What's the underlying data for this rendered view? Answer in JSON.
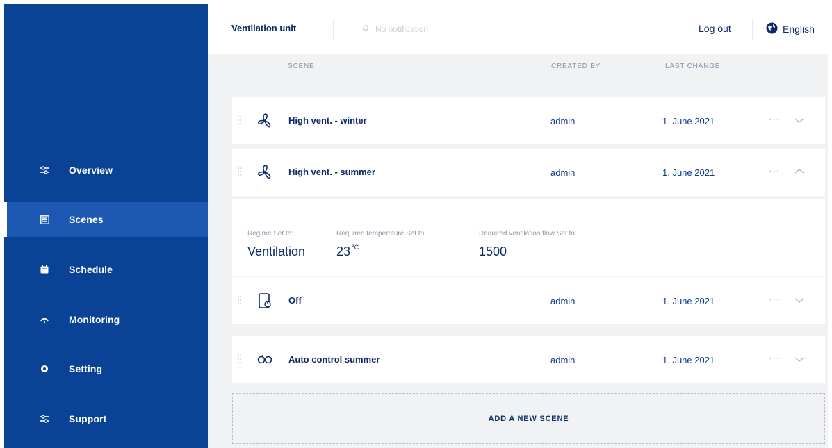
{
  "sidebar": {
    "items": [
      {
        "label": "Overview",
        "icon": "sliders-icon"
      },
      {
        "label": "Scenes",
        "icon": "list-icon",
        "active": true
      },
      {
        "label": "Schedule",
        "icon": "calendar-icon"
      },
      {
        "label": "Monitoring",
        "icon": "gauge-icon"
      },
      {
        "label": "Setting",
        "icon": "gear-icon"
      },
      {
        "label": "Support",
        "icon": "sliders-icon"
      }
    ]
  },
  "topbar": {
    "unit_title": "Ventilation unit",
    "notification": "No notification",
    "logout": "Log out",
    "language": "English"
  },
  "table": {
    "headers": {
      "scene": "SCENE",
      "created_by": "CREATED BY",
      "last_change": "LAST CHANGE"
    },
    "rows": [
      {
        "name": "High vent. - winter",
        "created_by": "admin",
        "last_change": "1. June 2021",
        "more": "···",
        "icon": "fan-icon",
        "expanded": false
      },
      {
        "name": "High vent. - summer",
        "created_by": "admin",
        "last_change": "1. June 2021",
        "more": "···",
        "icon": "fan-icon",
        "expanded": true
      },
      {
        "name": "Off",
        "created_by": "admin",
        "last_change": "1. June 2021",
        "more": "···",
        "icon": "power-off-icon",
        "expanded": false
      },
      {
        "name": "Auto control summer",
        "created_by": "admin",
        "last_change": "1. June 2021",
        "more": "···",
        "icon": "auto-control-icon",
        "expanded": false
      }
    ],
    "expanded_details": {
      "regime_label": "Regime Set to:",
      "regime_value": "Ventilation",
      "temp_label": "Required temperature Set to:",
      "temp_value": "23",
      "temp_unit": "°C",
      "flow_label": "Required ventilation flow Set to:",
      "flow_value": "1500"
    }
  },
  "add_scene": {
    "label": "ADD A NEW SCENE"
  },
  "colors": {
    "sidebar": "#0a4396",
    "sidebar_active": "#1d58b3",
    "text_dark": "#0b2a66",
    "background": "#f1f2f4"
  }
}
